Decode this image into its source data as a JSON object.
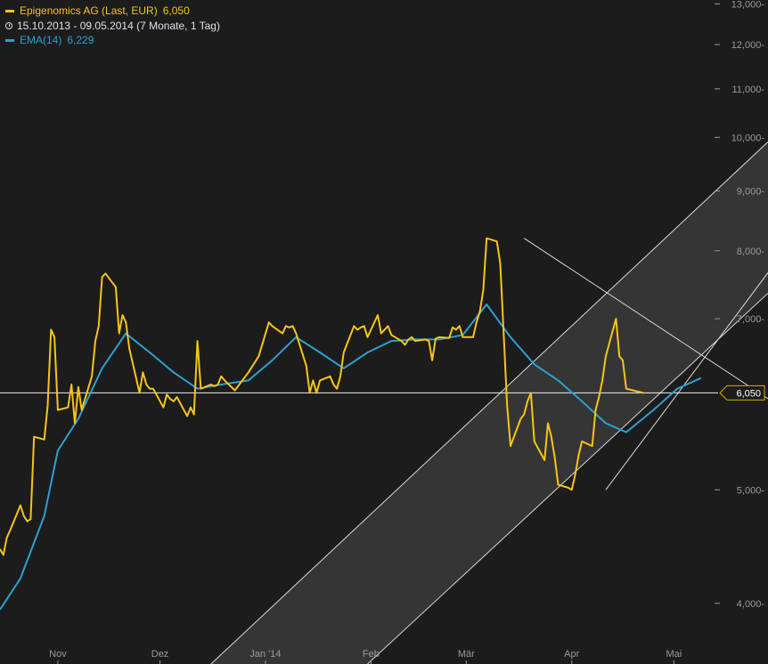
{
  "legend": {
    "main_label": "Epigenomics AG (Last, EUR)",
    "main_value": "6,050",
    "period": "15.10.2013 - 09.05.2014 (7 Monate, 1 Tag)",
    "ema_label": "EMA(14)",
    "ema_value": "6,229"
  },
  "colors": {
    "background": "#1c1c1c",
    "price": "#f5c518",
    "ema": "#2e9fd0",
    "channel_fill": "#3a3a3a",
    "lines": "#d8d8d8",
    "axis_text": "#9a9a9a"
  },
  "chart_data": {
    "type": "line",
    "title": "Epigenomics AG (Last, EUR)",
    "y_scale": "log",
    "ylim": [
      3.55,
      13.1
    ],
    "xlim": [
      "2013-10-15",
      "2014-05-14"
    ],
    "y_ticks": [
      {
        "value": 4,
        "label": "4,000"
      },
      {
        "value": 5,
        "label": "5,000"
      },
      {
        "value": 7,
        "label": "7,000"
      },
      {
        "value": 8,
        "label": "8,000"
      },
      {
        "value": 9,
        "label": "9,000"
      },
      {
        "value": 10,
        "label": "10,000"
      },
      {
        "value": 11,
        "label": "11,000"
      },
      {
        "value": 12,
        "label": "12,000"
      },
      {
        "value": 13,
        "label": "13,000"
      }
    ],
    "x_ticks": [
      {
        "date": "2013-11-01",
        "label": "Nov"
      },
      {
        "date": "2013-12-01",
        "label": "Dez"
      },
      {
        "date": "2014-01-01",
        "label": "Jan '14"
      },
      {
        "date": "2014-02-01",
        "label": "Feb"
      },
      {
        "date": "2014-03-01",
        "label": "Mär"
      },
      {
        "date": "2014-04-01",
        "label": "Apr"
      },
      {
        "date": "2014-05-01",
        "label": "Mai"
      }
    ],
    "last_value": 6.05,
    "last_value_label": "6,050",
    "reference_line": 6.05,
    "series": [
      {
        "name": "Epigenomics AG (Last, EUR)",
        "dates": [
          "2013-10-15",
          "2013-10-16",
          "2013-10-17",
          "2013-10-18",
          "2013-10-21",
          "2013-10-22",
          "2013-10-23",
          "2013-10-24",
          "2013-10-25",
          "2013-10-28",
          "2013-10-29",
          "2013-10-30",
          "2013-10-31",
          "2013-11-01",
          "2013-11-04",
          "2013-11-05",
          "2013-11-06",
          "2013-11-07",
          "2013-11-08",
          "2013-11-11",
          "2013-11-12",
          "2013-11-13",
          "2013-11-14",
          "2013-11-15",
          "2013-11-18",
          "2013-11-19",
          "2013-11-20",
          "2013-11-21",
          "2013-11-22",
          "2013-11-25",
          "2013-11-26",
          "2013-11-27",
          "2013-11-28",
          "2013-11-29",
          "2013-12-02",
          "2013-12-03",
          "2013-12-04",
          "2013-12-05",
          "2013-12-06",
          "2013-12-09",
          "2013-12-10",
          "2013-12-11",
          "2013-12-12",
          "2013-12-13",
          "2013-12-16",
          "2013-12-17",
          "2013-12-18",
          "2013-12-19",
          "2013-12-20",
          "2013-12-23",
          "2013-12-27",
          "2013-12-30",
          "2014-01-02",
          "2014-01-03",
          "2014-01-06",
          "2014-01-07",
          "2014-01-08",
          "2014-01-09",
          "2014-01-10",
          "2014-01-13",
          "2014-01-14",
          "2014-01-15",
          "2014-01-16",
          "2014-01-17",
          "2014-01-20",
          "2014-01-21",
          "2014-01-22",
          "2014-01-23",
          "2014-01-24",
          "2014-01-27",
          "2014-01-28",
          "2014-01-29",
          "2014-01-30",
          "2014-01-31",
          "2014-02-03",
          "2014-02-04",
          "2014-02-05",
          "2014-02-06",
          "2014-02-07",
          "2014-02-10",
          "2014-02-11",
          "2014-02-12",
          "2014-02-13",
          "2014-02-14",
          "2014-02-17",
          "2014-02-18",
          "2014-02-19",
          "2014-02-20",
          "2014-02-21",
          "2014-02-24",
          "2014-02-25",
          "2014-02-26",
          "2014-02-27",
          "2014-02-28",
          "2014-03-03",
          "2014-03-04",
          "2014-03-05",
          "2014-03-06",
          "2014-03-07",
          "2014-03-10",
          "2014-03-11",
          "2014-03-12",
          "2014-03-13",
          "2014-03-14",
          "2014-03-17",
          "2014-03-18",
          "2014-03-19",
          "2014-03-20",
          "2014-03-21",
          "2014-03-24",
          "2014-03-25",
          "2014-03-26",
          "2014-03-27",
          "2014-03-28",
          "2014-03-31",
          "2014-04-01",
          "2014-04-02",
          "2014-04-03",
          "2014-04-04",
          "2014-04-07",
          "2014-04-08",
          "2014-04-09",
          "2014-04-10",
          "2014-04-11",
          "2014-04-14",
          "2014-04-15",
          "2014-04-16",
          "2014-04-17",
          "2014-04-22",
          "2014-04-23",
          "2014-04-24",
          "2014-04-25",
          "2014-04-28",
          "2014-04-29",
          "2014-04-30",
          "2014-05-02",
          "2014-05-05",
          "2014-05-06",
          "2014-05-07",
          "2014-05-08",
          "2014-05-09"
        ],
        "values": [
          4.45,
          4.4,
          4.55,
          4.62,
          4.85,
          4.75,
          4.7,
          4.72,
          5.55,
          5.52,
          5.9,
          6.85,
          6.75,
          5.85,
          5.88,
          6.15,
          5.7,
          6.12,
          5.85,
          6.25,
          6.7,
          6.9,
          7.6,
          7.65,
          7.45,
          6.8,
          7.05,
          6.95,
          6.6,
          6.05,
          6.3,
          6.15,
          6.1,
          6.1,
          5.88,
          6.03,
          5.98,
          5.95,
          6.0,
          5.78,
          5.88,
          5.8,
          6.7,
          6.1,
          6.15,
          6.13,
          6.15,
          6.25,
          6.2,
          6.08,
          6.3,
          6.5,
          6.95,
          6.9,
          6.8,
          6.9,
          6.88,
          6.9,
          6.8,
          6.38,
          6.05,
          6.2,
          6.05,
          6.2,
          6.25,
          6.15,
          6.1,
          6.25,
          6.55,
          6.9,
          6.85,
          6.88,
          6.9,
          6.75,
          7.05,
          6.8,
          6.85,
          6.9,
          6.78,
          6.7,
          6.65,
          6.72,
          6.75,
          6.7,
          6.72,
          6.7,
          6.45,
          6.73,
          6.75,
          6.74,
          6.88,
          6.85,
          6.9,
          6.75,
          6.75,
          6.95,
          7.1,
          7.4,
          8.2,
          8.15,
          7.8,
          6.8,
          5.9,
          5.45,
          5.75,
          5.8,
          5.95,
          6.05,
          5.5,
          5.3,
          5.7,
          5.55,
          5.33,
          5.05,
          5.02,
          5.0,
          5.15,
          5.35,
          5.5,
          5.45,
          5.85,
          6.0,
          6.2,
          6.5,
          7.0,
          6.5,
          6.45,
          6.1,
          6.05
        ],
        "line_style": "solid"
      },
      {
        "name": "EMA(14)",
        "dates": [
          "2013-10-15",
          "2013-10-21",
          "2013-10-28",
          "2013-11-01",
          "2013-11-07",
          "2013-11-14",
          "2013-11-21",
          "2013-11-28",
          "2013-12-05",
          "2013-12-12",
          "2013-12-19",
          "2013-12-27",
          "2014-01-03",
          "2014-01-10",
          "2014-01-17",
          "2014-01-24",
          "2014-01-31",
          "2014-02-07",
          "2014-02-14",
          "2014-02-21",
          "2014-02-28",
          "2014-03-07",
          "2014-03-14",
          "2014-03-21",
          "2014-03-28",
          "2014-04-04",
          "2014-04-11",
          "2014-04-17",
          "2014-04-25",
          "2014-05-02",
          "2014-05-09"
        ],
        "values": [
          3.95,
          4.2,
          4.75,
          5.4,
          5.75,
          6.35,
          6.8,
          6.55,
          6.3,
          6.1,
          6.15,
          6.2,
          6.45,
          6.75,
          6.55,
          6.35,
          6.55,
          6.7,
          6.72,
          6.72,
          6.78,
          7.2,
          6.75,
          6.4,
          6.2,
          5.95,
          5.7,
          5.6,
          5.85,
          6.1,
          6.23
        ],
        "line_style": "solid"
      }
    ],
    "trendlines": [
      {
        "from": {
          "date": "2014-03-18",
          "value": 8.2
        },
        "to": {
          "date": "2014-05-14",
          "value": 6.38
        }
      },
      {
        "from": {
          "date": "2014-04-11",
          "value": 5.0
        },
        "to": {
          "date": "2014-05-14",
          "value": 6.72
        }
      }
    ],
    "channel": {
      "upper": {
        "from": {
          "date": "2013-12-16",
          "value": 3.55
        },
        "to": {
          "date": "2014-05-14",
          "value": 9.04
        }
      },
      "lower": {
        "from": {
          "date": "2014-01-31",
          "value": 3.55
        },
        "to": {
          "date": "2014-05-14",
          "value": 6.72
        }
      }
    }
  }
}
